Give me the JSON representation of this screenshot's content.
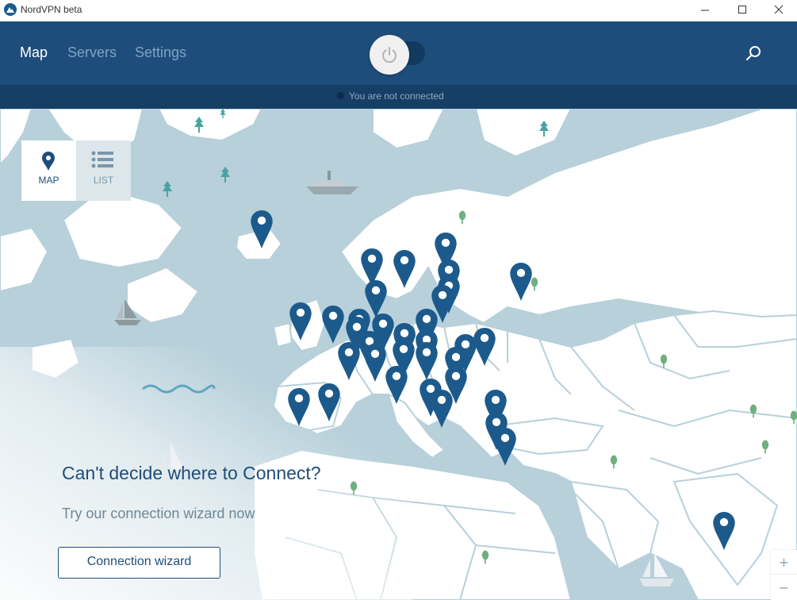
{
  "window": {
    "title": "NordVPN beta"
  },
  "nav": {
    "tabs": [
      {
        "label": "Map",
        "active": true
      },
      {
        "label": "Servers",
        "active": false
      },
      {
        "label": "Settings",
        "active": false
      }
    ]
  },
  "connection": {
    "status_text": "You are not connected",
    "connected": false
  },
  "view_toggle": {
    "map_label": "MAP",
    "list_label": "LIST",
    "selected": "MAP"
  },
  "wizard": {
    "title": "Can't decide where to Connect?",
    "subtitle": "Try our connection wizard now",
    "button_label": "Connection wizard"
  },
  "zoom": {
    "in_label": "+",
    "out_label": "−"
  },
  "colors": {
    "header": "#1e4d7b",
    "status_bar": "#163f66",
    "sea": "#b7d0da",
    "land": "#ffffff",
    "pin": "#1c5a8c",
    "tree": "#6fb07e"
  },
  "icons": [
    "app-logo-icon",
    "minimize-icon",
    "maximize-icon",
    "close-icon",
    "power-icon",
    "search-icon",
    "map-pin-icon",
    "list-icon",
    "location-pin-icon",
    "tree-icon",
    "boat-icon"
  ]
}
